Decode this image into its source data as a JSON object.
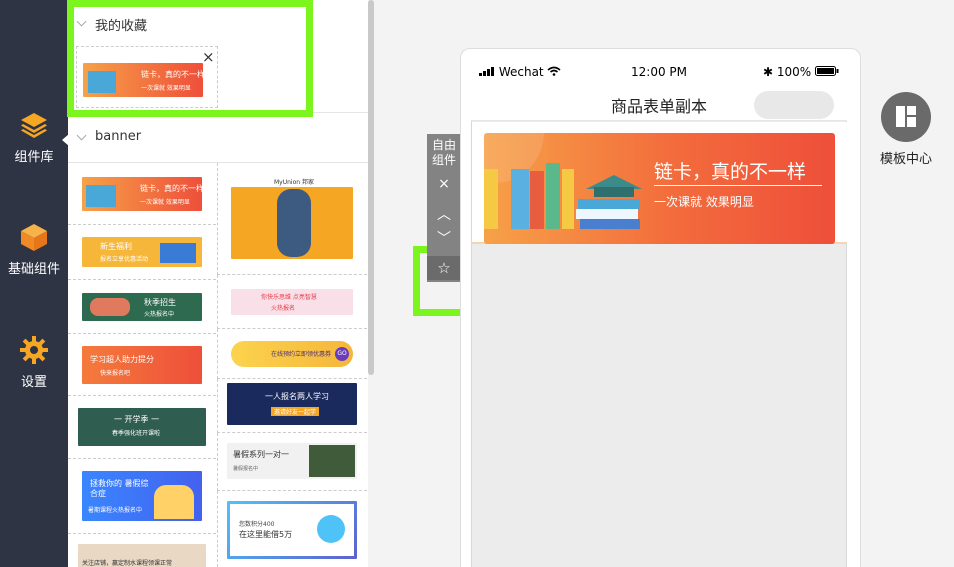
{
  "nav": {
    "items": [
      {
        "label": "组件库",
        "icon": "layers-icon"
      },
      {
        "label": "基础组件",
        "icon": "cube-icon"
      },
      {
        "label": "设置",
        "icon": "gear-icon"
      }
    ]
  },
  "panel": {
    "favorites_title": "我的收藏",
    "banner_title": "banner",
    "favorite_item": {
      "main": "链卡，真的不一样",
      "sub": "一次课就 效果明显",
      "close": "×"
    },
    "left_tiles": [
      {
        "main": "链卡，真的不一样",
        "sub": "一次课就 效果明显"
      },
      {
        "main": "新生福利",
        "sub": "报名立享优惠活动"
      },
      {
        "main": "秋季招生",
        "sub": "火热报名中"
      },
      {
        "main": "学习超人助力提分",
        "sub": "快来报名吧"
      },
      {
        "main": "一 开学季 一",
        "sub": "春季强化班开课啦"
      },
      {
        "main": "拯救你的 暑假综合症",
        "sub": "暑期课程火热报名中"
      },
      {
        "main": "关注店铺，赢定制水课程领课正常"
      }
    ],
    "right_tiles": [
      {
        "main": "MyUnion 邦家"
      },
      {
        "main": "你快乐思维 点亮智慧",
        "sub": "火热报名"
      },
      {
        "main": "在线预约立即领优惠券",
        "badge": "GO"
      },
      {
        "main": "一人报名两人学习",
        "sub": "邀请好友一起学"
      },
      {
        "main": "暑假系列一对一",
        "sub": "暑假报名中"
      },
      {
        "main": "您数积分400",
        "sub": "在这里能借5万"
      }
    ]
  },
  "free_bar": {
    "label": "自由组件",
    "close": "×",
    "up": "︿",
    "down": "﹀",
    "star": "☆"
  },
  "phone": {
    "carrier": "Wechat",
    "time": "12:00 PM",
    "battery": "100%",
    "title": "商品表单副本",
    "banner": {
      "main": "链卡，真的不一样",
      "sub": "一次课就 效果明显"
    }
  },
  "template_center": {
    "label": "模板中心"
  },
  "colors": {
    "highlight": "#7cf51e",
    "nav_bg": "#2f3444",
    "accent_orange": "#f36b3c"
  }
}
